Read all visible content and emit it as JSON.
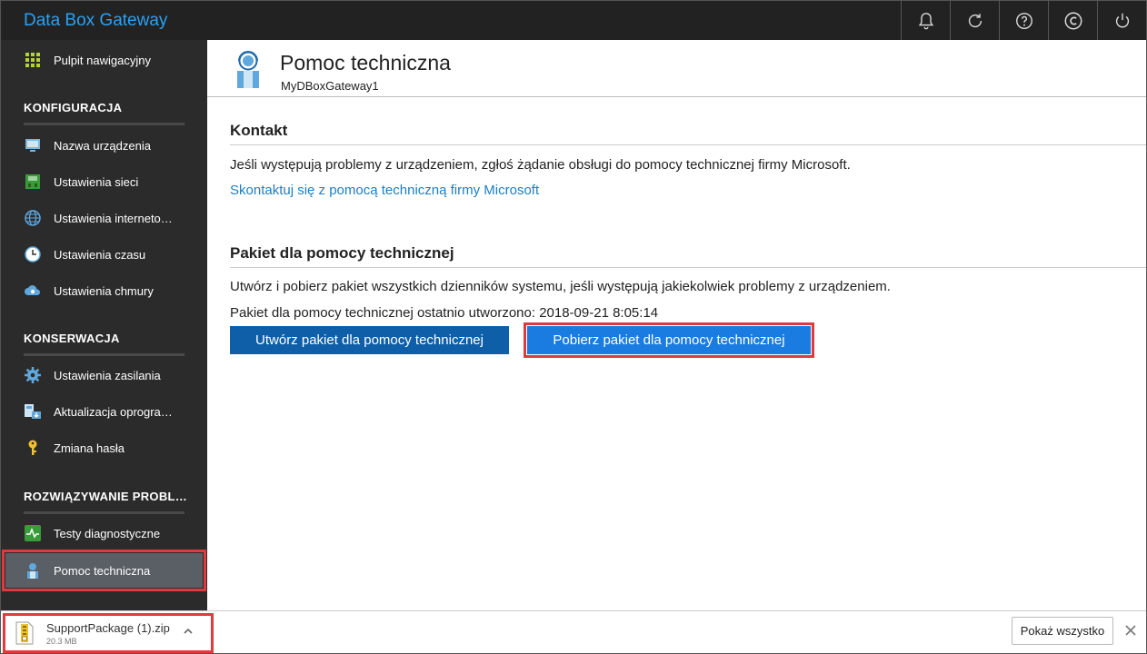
{
  "app": {
    "title": "Data Box Gateway"
  },
  "topbar": {
    "icons": [
      "bell-icon",
      "refresh-icon",
      "help-icon",
      "copyright-icon",
      "power-icon"
    ]
  },
  "sidebar": {
    "dashboard": {
      "label": "Pulpit nawigacyjny",
      "icon": "grid-icon"
    },
    "sections": [
      {
        "title": "KONFIGURACJA",
        "items": [
          {
            "label": "Nazwa urządzenia",
            "icon": "device-icon"
          },
          {
            "label": "Ustawienia sieci",
            "icon": "network-icon"
          },
          {
            "label": "Ustawienia internetowego serwera proxy",
            "icon": "globe-icon"
          },
          {
            "label": "Ustawienia czasu",
            "icon": "clock-icon"
          },
          {
            "label": "Ustawienia chmury",
            "icon": "cloud-icon"
          }
        ]
      },
      {
        "title": "KONSERWACJA",
        "items": [
          {
            "label": "Ustawienia zasilania",
            "icon": "gear-icon"
          },
          {
            "label": "Aktualizacja oprogramowania",
            "icon": "update-icon"
          },
          {
            "label": "Zmiana hasła",
            "icon": "key-icon"
          }
        ]
      },
      {
        "title": "ROZWIĄZYWANIE PROBLEMÓW",
        "items": [
          {
            "label": "Testy diagnostyczne",
            "icon": "pulse-icon"
          },
          {
            "label": "Pomoc techniczna",
            "icon": "support-icon",
            "active": true
          }
        ]
      }
    ]
  },
  "page": {
    "title": "Pomoc techniczna",
    "subtitle": "MyDBoxGateway1",
    "contact": {
      "title": "Kontakt",
      "text": "Jeśli występują problemy z urządzeniem, zgłoś żądanie obsługi do pomocy technicznej firmy Microsoft.",
      "link": "Skontaktuj się z pomocą techniczną firmy Microsoft"
    },
    "package": {
      "title": "Pakiet dla pomocy technicznej",
      "text": "Utwórz i pobierz pakiet wszystkich dzienników systemu, jeśli występują jakiekolwiek problemy z urządzeniem.",
      "last_created": "Pakiet dla pomocy technicznej ostatnio utworzono: 2018-09-21 8:05:14",
      "create_label": "Utwórz pakiet dla pomocy technicznej",
      "download_label": "Pobierz pakiet dla pomocy technicznej"
    }
  },
  "downloads": {
    "file_name": "SupportPackage (1).zip",
    "file_size": "20.3 MB",
    "show_all": "Pokaż wszystko"
  },
  "colors": {
    "accent": "#2aa1f5",
    "sidebar_bg": "#2b2b2b",
    "highlight": "#e03a3e",
    "button_primary": "#0f5fa8",
    "button_download": "#1a7ce0"
  }
}
